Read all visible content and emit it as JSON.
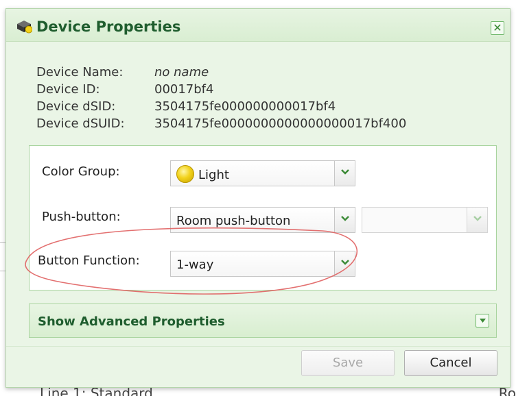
{
  "background": {
    "bottom_left_text": "Line 1: Standard",
    "bottom_right_text": "Ro"
  },
  "dialog": {
    "title": "Device Properties",
    "close_symbol": "✕",
    "info": [
      {
        "label": "Device Name:",
        "value": "no name"
      },
      {
        "label": "Device ID:",
        "value": "00017bf4"
      },
      {
        "label": "Device dSID:",
        "value": "3504175fe000000000017bf4"
      },
      {
        "label": "Device dSUID:",
        "value": "3504175fe0000000000000000017bf400"
      }
    ],
    "fields": {
      "color_group": {
        "label": "Color Group:",
        "value": "Light",
        "color": "#f2d21b"
      },
      "push_button": {
        "label": "Push-button:",
        "value": "Room push-button",
        "secondary_value": ""
      },
      "button_function": {
        "label": "Button Function:",
        "value": "1-way"
      }
    },
    "advanced_label": "Show Advanced Properties",
    "buttons": {
      "save": "Save",
      "cancel": "Cancel"
    }
  },
  "colors": {
    "accent": "#1f5d2e",
    "panel_bg": "#eaf5e6",
    "border": "#a9d49f",
    "annotation": "#e06060"
  }
}
